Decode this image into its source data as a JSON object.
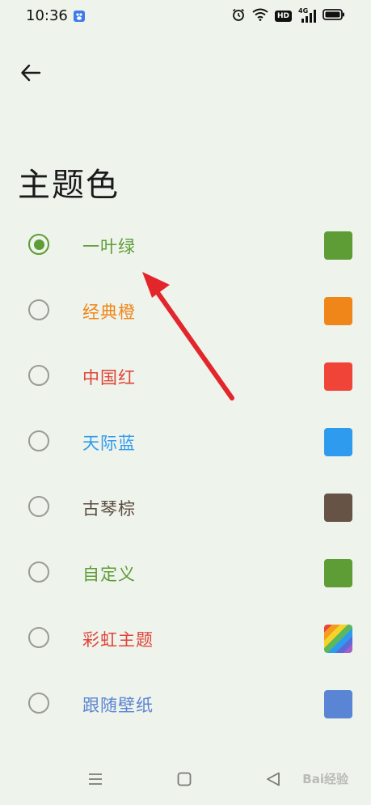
{
  "status_bar": {
    "time": "10:36",
    "hd_label": "HD",
    "network_label": "4G",
    "icons": [
      "app-icon",
      "alarm-icon",
      "wifi-icon",
      "signal-icon",
      "battery-icon"
    ]
  },
  "header": {
    "back_icon": "arrow-left-icon",
    "title": "主题色"
  },
  "themes": [
    {
      "label": "一叶绿",
      "color": "#5e9c36",
      "swatch": "#5e9c36",
      "selected": true
    },
    {
      "label": "经典橙",
      "color": "#f0861a",
      "swatch": "#f0861a",
      "selected": false
    },
    {
      "label": "中国红",
      "color": "#e0443a",
      "swatch": "#f04438",
      "selected": false
    },
    {
      "label": "天际蓝",
      "color": "#2f9bef",
      "swatch": "#2f9bef",
      "selected": false
    },
    {
      "label": "古琴棕",
      "color": "#5a4c42",
      "swatch": "#675345",
      "selected": false
    },
    {
      "label": "自定义",
      "color": "#5e9c36",
      "swatch": "#5e9c36",
      "selected": false
    },
    {
      "label": "彩虹主题",
      "color": "#e0443a",
      "swatch": "rainbow",
      "selected": false
    },
    {
      "label": "跟随壁纸",
      "color": "#5a84d4",
      "swatch": "#5a84d4",
      "selected": false
    }
  ],
  "annotation": {
    "arrow_color": "#e3262c"
  },
  "navbar": {
    "icons": [
      "menu-icon",
      "home-icon",
      "back-triangle-icon"
    ]
  },
  "watermark": "Bai经验"
}
